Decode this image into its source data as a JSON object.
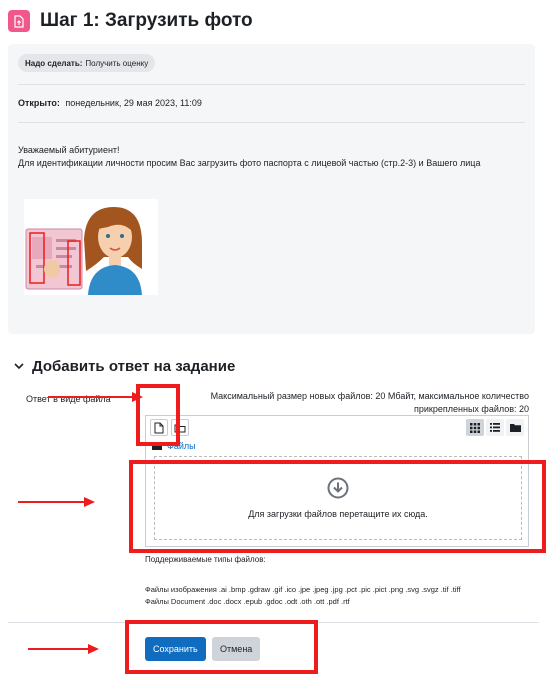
{
  "header": {
    "title": "Шаг 1: Загрузить фото",
    "icon": "assignment-upload-icon",
    "icon_color": "#f0578a"
  },
  "info": {
    "todo_label": "Надо сделать:",
    "todo_value": "Получить оценку",
    "opened_label": "Открыто:",
    "opened_value": "понедельник, 29 мая 2023, 11:09",
    "greeting": "Уважаемый абитуриент!",
    "instruction": "Для идентификации личности просим Вас загрузить фото паспорта с лицевой частью (стр.2-3) и Вашего лица"
  },
  "submission": {
    "section_title": "Добавить ответ на задание",
    "field_label": "Ответ в виде файла",
    "limits": "Максимальный размер новых файлов: 20 Мбайт, максимальное количество прикрепленных файлов: 20",
    "toolbar": {
      "add_icon": "add-file-icon",
      "folder_icon": "create-folder-icon"
    },
    "views": [
      "grid-view-icon",
      "list-view-icon",
      "tree-view-icon"
    ],
    "path_label": "Файлы",
    "drop_text": "Для загрузки файлов перетащите их сюда.",
    "supported_label": "Поддерживаемые типы файлов:",
    "types_images": "Файлы изображения .ai .bmp .gdraw .gif .ico .jpe .jpeg .jpg .pct .pic .pict .png .svg .svgz .tif .tiff",
    "types_docs": "Файлы Document .doc .docx .epub .gdoc .odt .oth .ott .pdf .rtf"
  },
  "buttons": {
    "save": "Сохранить",
    "cancel": "Отмена"
  },
  "colors": {
    "primary": "#0f6cbf",
    "annotation": "#ee1c1c",
    "box_bg": "#f5f6f8"
  }
}
